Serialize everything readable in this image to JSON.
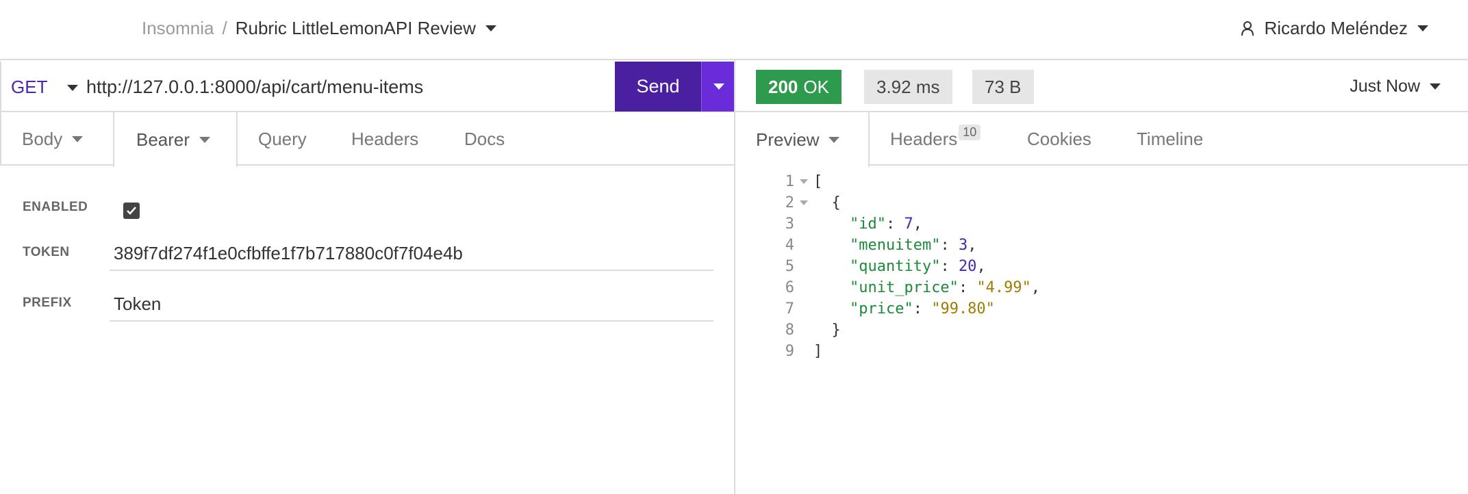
{
  "header": {
    "breadcrumb_root": "Insomnia",
    "breadcrumb_sep": "/",
    "breadcrumb_current": "Rubric LittleLemonAPI Review",
    "user_name": "Ricardo Meléndez"
  },
  "request": {
    "method": "GET",
    "url": "http://127.0.0.1:8000/api/cart/menu-items",
    "send_label": "Send"
  },
  "response": {
    "status_code": "200",
    "status_text": "OK",
    "time": "3.92 ms",
    "size": "73 B",
    "timestamp": "Just Now"
  },
  "left_tabs": {
    "body": "Body",
    "auth": "Bearer",
    "query": "Query",
    "headers": "Headers",
    "docs": "Docs"
  },
  "right_tabs": {
    "preview": "Preview",
    "headers": "Headers",
    "headers_count": "10",
    "cookies": "Cookies",
    "timeline": "Timeline"
  },
  "auth": {
    "enabled_label": "ENABLED",
    "token_label": "TOKEN",
    "token_value": "389f7df274f1e0cfbffe1f7b717880c0f7f04e4b",
    "prefix_label": "PREFIX",
    "prefix_value": "Token"
  },
  "preview": {
    "lines": {
      "n1": "1",
      "n2": "2",
      "n3": "3",
      "n4": "4",
      "n5": "5",
      "n6": "6",
      "n7": "7",
      "n8": "8",
      "n9": "9",
      "open_bracket": "[",
      "open_brace": "  {",
      "k_id": "\"id\"",
      "v_id": "7",
      "k_menuitem": "\"menuitem\"",
      "v_menuitem": "3",
      "k_quantity": "\"quantity\"",
      "v_quantity": "20",
      "k_unit_price": "\"unit_price\"",
      "v_unit_price": "\"4.99\"",
      "k_price": "\"price\"",
      "v_price": "\"99.80\"",
      "close_brace": "  }",
      "close_bracket": "]"
    }
  },
  "colors": {
    "accent": "#4a1fa0",
    "success": "#2d9a4e",
    "json_key": "#1b8a3a",
    "json_number": "#3f2ab0",
    "json_string": "#a07c00"
  }
}
